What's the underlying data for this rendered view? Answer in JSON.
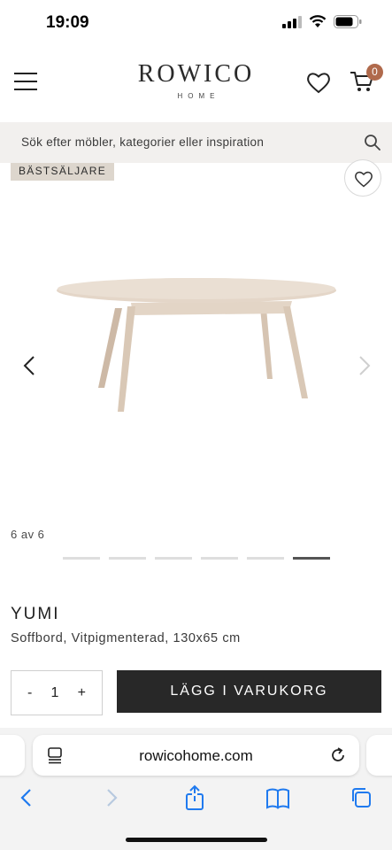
{
  "status": {
    "time": "19:09"
  },
  "header": {
    "logo_main": "ROWICO",
    "logo_sub": "HOME",
    "cart_count": "0"
  },
  "search": {
    "placeholder": "Sök efter möbler, kategorier eller inspiration"
  },
  "gallery": {
    "badge": "BÄSTSÄLJARE",
    "counter": "6 av 6",
    "total_images": 6,
    "active_index": 6
  },
  "product": {
    "name": "YUMI",
    "description": "Soffbord, Vitpigmenterad, 130x65 cm",
    "quantity": "1",
    "qty_minus": "-",
    "qty_plus": "+",
    "add_to_cart": "LÄGG I VARUKORG"
  },
  "browser": {
    "url": "rowicohome.com"
  },
  "colors": {
    "badge_bg": "#ddd6cd",
    "cart_badge": "#b06a4c",
    "primary_button": "#282828",
    "ios_blue": "#1f7aef"
  }
}
